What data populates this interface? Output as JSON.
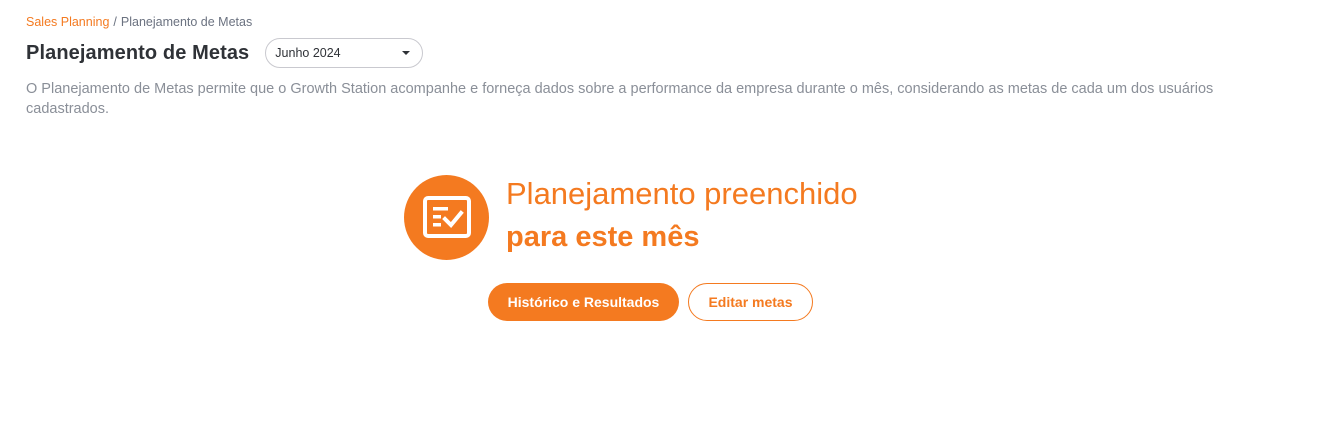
{
  "breadcrumb": {
    "parent": "Sales Planning",
    "separator": "/",
    "current": "Planejamento de Metas"
  },
  "header": {
    "title": "Planejamento de Metas",
    "month_select": {
      "value": "Junho 2024"
    }
  },
  "description": "O Planejamento de Metas permite que o Growth Station acompanhe e forneça dados sobre a performance da empresa durante o mês, considerando as metas de cada um dos usuários cadastrados.",
  "status": {
    "icon": "checklist-icon",
    "line1": "Planejamento preenchido",
    "line2": "para este mês"
  },
  "actions": {
    "history_label": "Histórico e Resultados",
    "edit_label": "Editar metas"
  },
  "colors": {
    "accent": "#f47a20",
    "title": "#2f3237",
    "muted": "#8a8f98"
  }
}
